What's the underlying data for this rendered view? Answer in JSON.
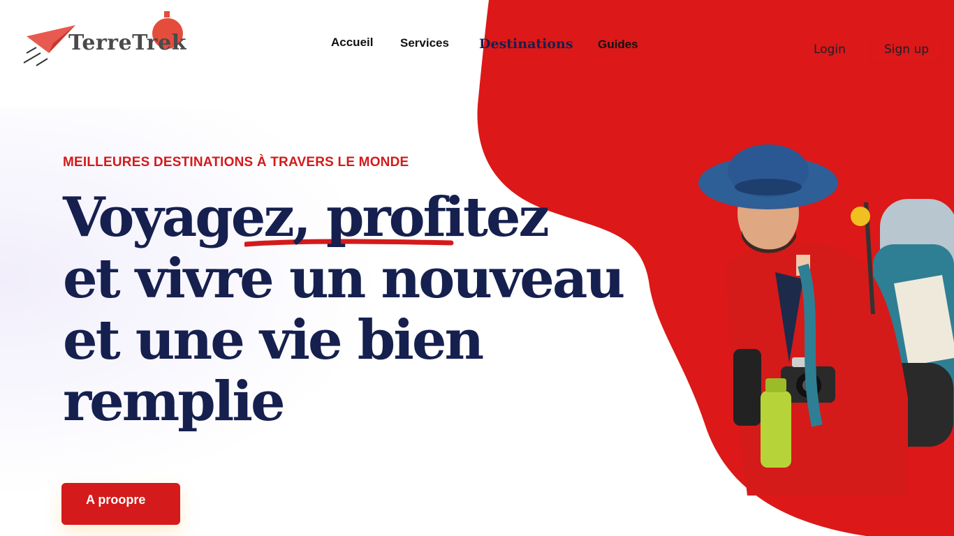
{
  "brand": {
    "name": "TerreTrek",
    "accent": "#d41a1a",
    "navy": "#16204f"
  },
  "nav": {
    "items": [
      {
        "label": "Accueil"
      },
      {
        "label": "Services"
      },
      {
        "label": "Destinations"
      },
      {
        "label": "Guides"
      }
    ]
  },
  "auth": {
    "login_label": "Login",
    "signup_label": "Sign up"
  },
  "hero": {
    "eyebrow": "MEILLEURES DESTINATIONS À TRAVERS LE MONDE",
    "headline_lines": [
      "Voyagez, profitez",
      "et vivre un nouveau",
      "et une vie bien",
      "remplie"
    ],
    "cta_label": "A proopre"
  },
  "icons": {
    "logo": "paper-plane-icon",
    "hero": "traveler-illustration"
  }
}
